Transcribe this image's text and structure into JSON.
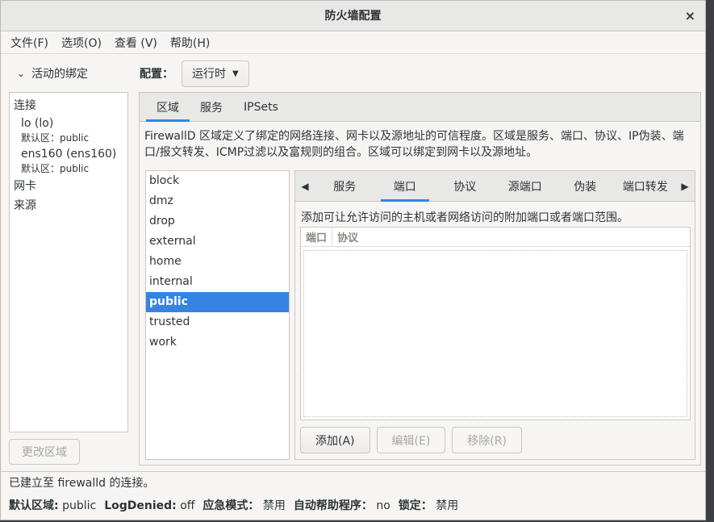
{
  "window": {
    "title": "防火墙配置",
    "close_glyph": "×"
  },
  "menu": [
    "文件(F)",
    "选项(O)",
    "查看 (V)",
    "帮助(H)"
  ],
  "bindings": {
    "header": "活动的绑定",
    "connections_label": "连接",
    "connections": [
      {
        "name": "lo (lo)",
        "zone": "默认区：public"
      },
      {
        "name": "ens160 (ens160)",
        "zone": "默认区：public"
      }
    ],
    "interfaces_label": "网卡",
    "sources_label": "来源",
    "change_zone_button": "更改区域"
  },
  "config": {
    "label": "配置：",
    "value": "运行时"
  },
  "main_tabs": [
    {
      "label": "区域",
      "active": true
    },
    {
      "label": "服务",
      "active": false
    },
    {
      "label": "IPSets",
      "active": false
    }
  ],
  "zone_description": "FirewallD 区域定义了绑定的网络连接、网卡以及源地址的可信程度。区域是服务、端口、协议、IP伪装、端口/报文转发、ICMP过滤以及富规则的组合。区域可以绑定到网卡以及源地址。",
  "zones": [
    "block",
    "dmz",
    "drop",
    "external",
    "home",
    "internal",
    "public",
    "trusted",
    "work"
  ],
  "selected_zone": "public",
  "sub_tabs": [
    {
      "label": "服务",
      "active": false
    },
    {
      "label": "端口",
      "active": true
    },
    {
      "label": "协议",
      "active": false
    },
    {
      "label": "源端口",
      "active": false
    },
    {
      "label": "伪装",
      "active": false
    },
    {
      "label": "端口转发",
      "active": false
    }
  ],
  "ports": {
    "description": "添加可让允许访问的主机或者网络访问的附加端口或者端口范围。",
    "columns": [
      "端口",
      "协议"
    ],
    "rows": [],
    "buttons": {
      "add": "添加(A)",
      "edit": "编辑(E)",
      "remove": "移除(R)"
    }
  },
  "status": {
    "connection": "已建立至 firewalld 的连接。",
    "default_zone_key": "默认区域:",
    "default_zone_val": "public",
    "log_denied_key": "LogDenied:",
    "log_denied_val": "off",
    "panic_key": "应急模式：",
    "panic_val": "禁用",
    "helpers_key": "自动帮助程序：",
    "helpers_val": "no",
    "lockdown_key": "锁定：",
    "lockdown_val": "禁用"
  }
}
